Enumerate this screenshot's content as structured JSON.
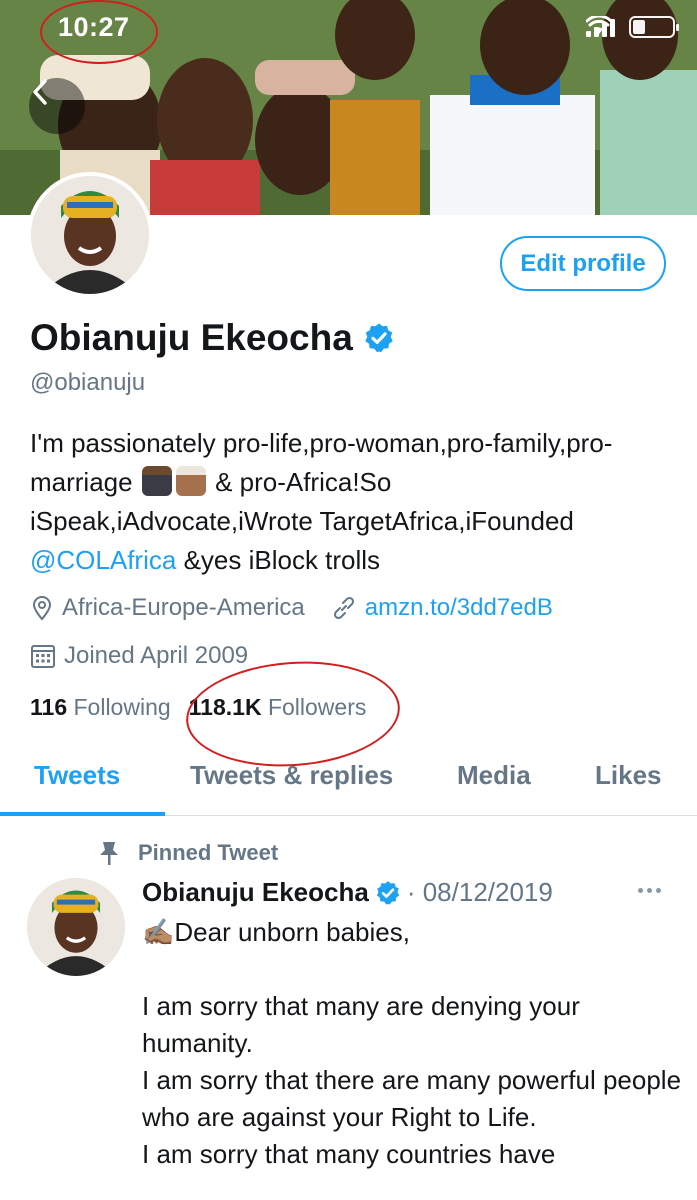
{
  "status_bar": {
    "time": "10:27"
  },
  "profile": {
    "edit_button": "Edit profile",
    "name": "Obianuju Ekeocha",
    "handle": "@obianuju",
    "bio_part1": "I'm passionately pro-life,pro-woman,pro-family,pro-marriage",
    "bio_part2": "& pro-Africa!So iSpeak,iAdvocate,iWrote TargetAfrica,iFounded",
    "bio_mention": "@COLAfrica",
    "bio_part3": "&yes iBlock trolls",
    "location": "Africa-Europe-America",
    "website": "amzn.to/3dd7edB",
    "joined": "Joined April 2009",
    "following_count": "116",
    "following_label": "Following",
    "followers_count": "118.1K",
    "followers_label": "Followers"
  },
  "tabs": [
    {
      "label": "Tweets"
    },
    {
      "label": "Tweets & replies"
    },
    {
      "label": "Media"
    },
    {
      "label": "Likes"
    }
  ],
  "tweet": {
    "pinned_label": "Pinned Tweet",
    "author": "Obianuju Ekeocha",
    "date": "· 08/12/2019",
    "text": "✍🏽Dear unborn babies,\n\nI am sorry that many are denying your humanity.\nI am sorry that there are many powerful people who are against your Right to Life.\nI am sorry that many countries have"
  },
  "colors": {
    "accent": "#1da1f2",
    "secondary_text": "#657786",
    "annotation": "#d11f1f"
  },
  "icons": [
    "chevron-left-icon",
    "signal-icon",
    "wifi-icon",
    "battery-icon",
    "verified-icon",
    "location-icon",
    "link-icon",
    "calendar-icon",
    "pin-icon",
    "more-icon"
  ]
}
